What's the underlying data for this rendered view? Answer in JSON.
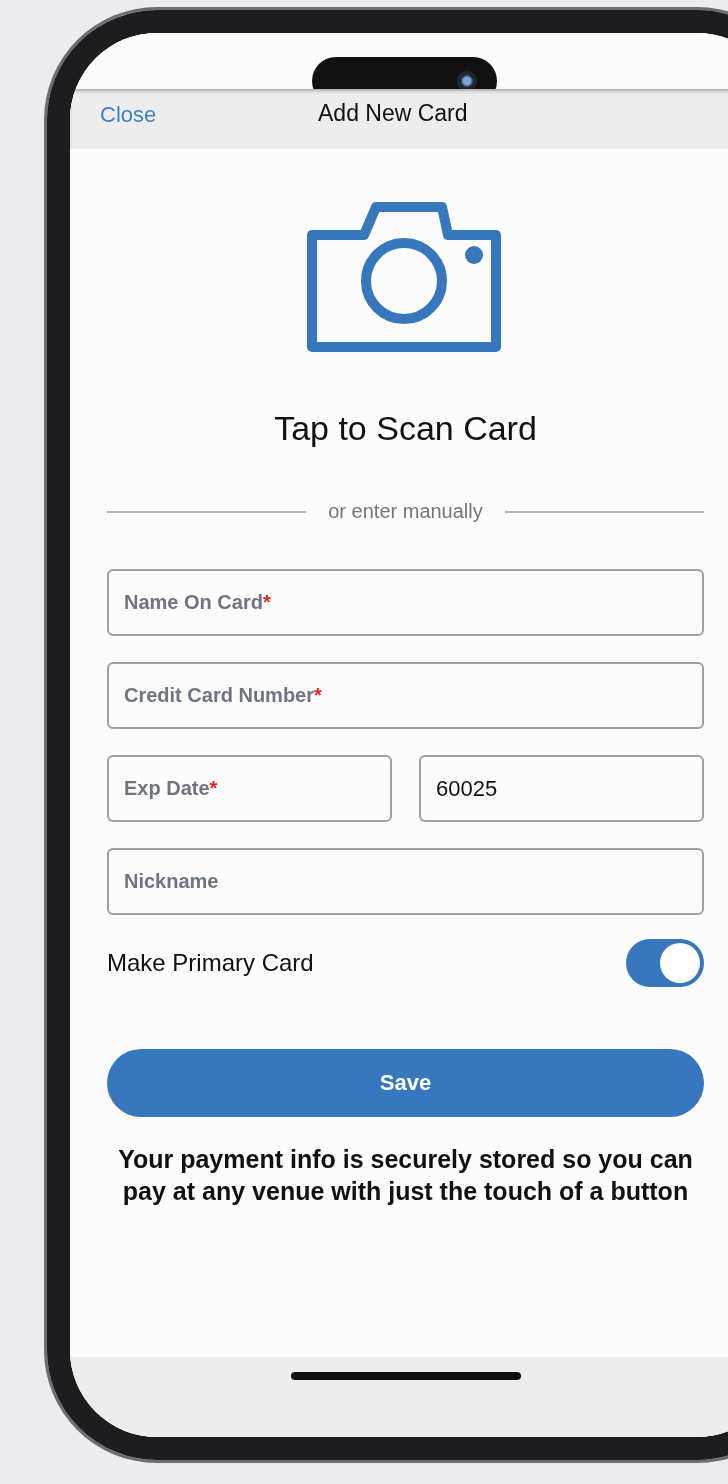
{
  "header": {
    "close": "Close",
    "title": "Add New Card"
  },
  "scan": {
    "label": "Tap to Scan Card"
  },
  "divider_text": "or enter manually",
  "field_rows": [
    [
      {
        "placeholder": "Name On Card",
        "required_mark": "*"
      }
    ],
    [
      {
        "placeholder": "Credit Card Number",
        "required_mark": "*"
      }
    ],
    [
      {
        "placeholder": "Exp Date",
        "required_mark": "*"
      },
      {
        "value": "60025"
      }
    ],
    [
      {
        "placeholder": "Nickname"
      }
    ]
  ],
  "primary_toggle": {
    "label": "Make Primary Card",
    "on": true
  },
  "save_button": "Save",
  "footer_note": "Your payment info is securely stored so you can pay at any venue with just the touch of a button"
}
